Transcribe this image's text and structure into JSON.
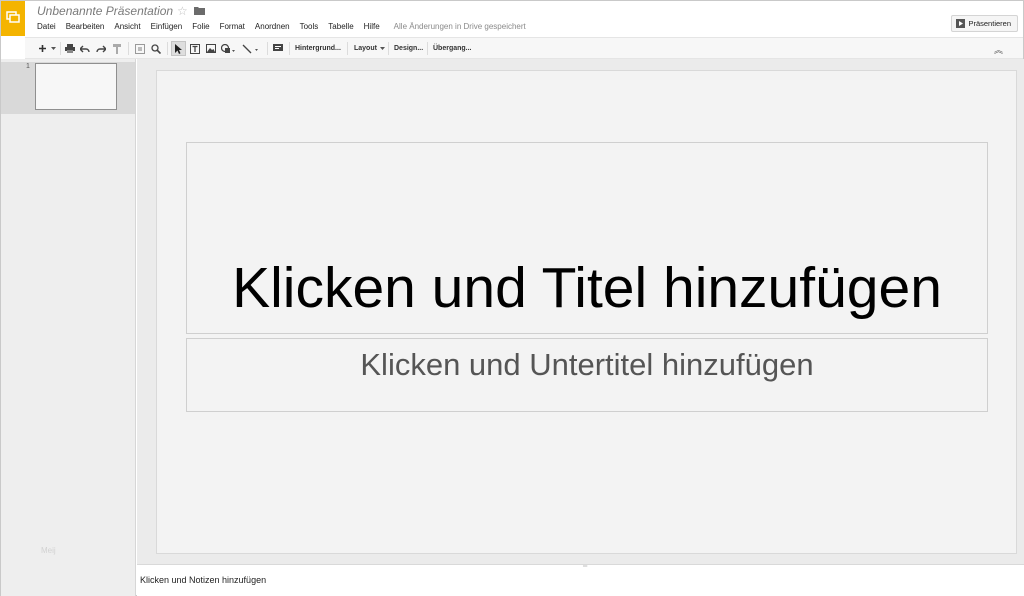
{
  "app": {
    "title": "Unbenannte Präsentation",
    "accent_color": "#f4b400",
    "logo_icon": "slides-logo-icon"
  },
  "menubar": {
    "items": [
      "Datei",
      "Bearbeiten",
      "Ansicht",
      "Einfügen",
      "Folie",
      "Format",
      "Anordnen",
      "Tools",
      "Tabelle",
      "Hilfe"
    ],
    "save_status": "Alle Änderungen in Drive gespeichert"
  },
  "header": {
    "present_label": "Präsentieren"
  },
  "toolbar": {
    "icons": [
      "new-slide-icon",
      "dropdown-arrow-icon",
      "print-icon",
      "undo-icon",
      "redo-icon",
      "paint-format-icon",
      "zoom-fit-icon",
      "zoom-icon",
      "select-icon",
      "text-box-icon",
      "image-icon",
      "shape-icon",
      "line-icon",
      "comment-icon",
      "collapse-icon"
    ],
    "background_label": "Hintergrund...",
    "layout_label": "Layout",
    "design_label": "Design...",
    "transition_label": "Übergang..."
  },
  "filmstrip": {
    "slide_number": "1",
    "ghost_label": "Meij"
  },
  "slide": {
    "title_placeholder": "Klicken und Titel hinzufügen",
    "subtitle_placeholder": "Klicken und Untertitel hinzufügen"
  },
  "notes": {
    "placeholder": "Klicken und Notizen hinzufügen"
  }
}
